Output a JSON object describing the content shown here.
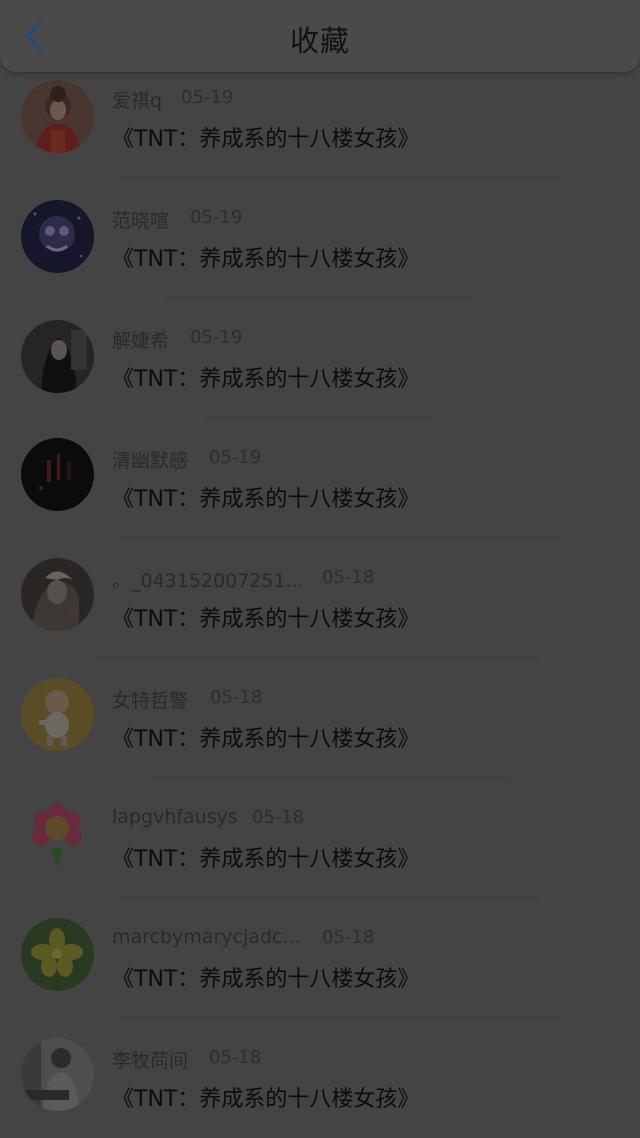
{
  "header": {
    "title": "收藏",
    "back_icon": "chevron-left-icon",
    "accent_color": "#1f4f7a"
  },
  "items": [
    {
      "name": "爱祺q",
      "date": "05-19",
      "content": "《TNT：养成系的十八楼女孩》",
      "avatar": "avatar-girl-red-dress"
    },
    {
      "name": "范晓喧",
      "date": "05-19",
      "content": "《TNT：养成系的十八楼女孩》",
      "avatar": "avatar-cartoon-night"
    },
    {
      "name": "解婕希",
      "date": "05-19",
      "content": "《TNT：养成系的十八楼女孩》",
      "avatar": "avatar-girl-dark"
    },
    {
      "name": "清幽默感",
      "date": "05-19",
      "content": "《TNT：养成系的十八楼女孩》",
      "avatar": "avatar-dark-scene"
    },
    {
      "name": "。_043152007251...",
      "date": "05-18",
      "content": "《TNT：养成系的十八楼女孩》",
      "avatar": "avatar-anime-figure"
    },
    {
      "name": "女特哲警",
      "date": "05-18",
      "content": "《TNT：养成系的十八楼女孩》",
      "avatar": "avatar-cartoon-baby"
    },
    {
      "name": "lapgvhfausys",
      "date": "05-18",
      "content": "《TNT：养成系的十八楼女孩》",
      "avatar": "avatar-cartoon-flower"
    },
    {
      "name": "marcbymarycjadc...",
      "date": "05-18",
      "content": "《TNT：养成系的十八楼女孩》",
      "avatar": "avatar-yellow-flower"
    },
    {
      "name": "李牧苘间",
      "date": "05-18",
      "content": "《TNT：养成系的十八楼女孩》",
      "avatar": "avatar-person-photo"
    }
  ]
}
